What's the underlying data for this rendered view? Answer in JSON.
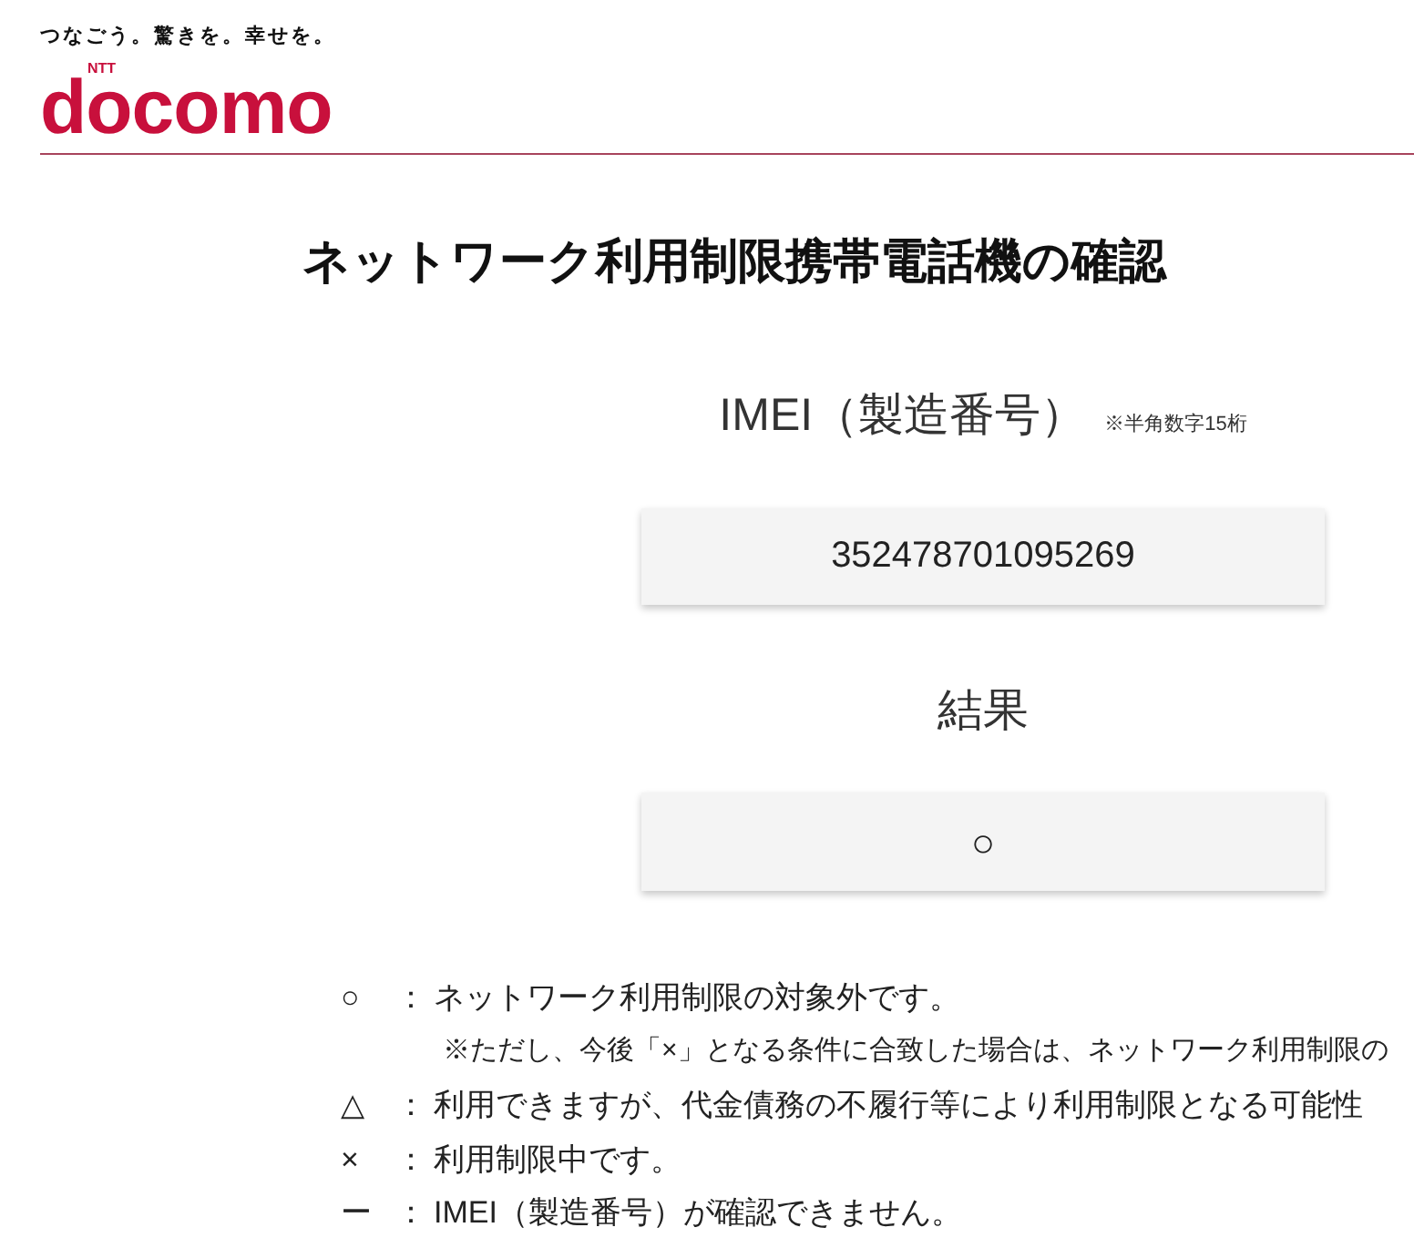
{
  "header": {
    "tagline": "つなごう。驚きを。幸せを。",
    "logo": {
      "mark": "NTT",
      "word": "docomo"
    }
  },
  "title": "ネットワーク利用制限携帯電話機の確認",
  "imei_field": {
    "label": "IMEI（製造番号）",
    "note": "※半角数字15桁",
    "value": "352478701095269"
  },
  "result": {
    "label": "結果",
    "value": "○"
  },
  "legend": [
    {
      "kind": "entry",
      "symbol": "○",
      "separator": "：",
      "text": "ネットワーク利用制限の対象外です。"
    },
    {
      "kind": "note",
      "text": "※ただし、今後「×」となる条件に合致した場合は、ネットワーク利用制限の"
    },
    {
      "kind": "entry",
      "symbol": "△",
      "separator": "：",
      "text": "利用できますが、代金債務の不履行等により利用制限となる可能性"
    },
    {
      "kind": "entry",
      "symbol": "×",
      "separator": "：",
      "text": "利用制限中です。"
    },
    {
      "kind": "entry",
      "symbol": "ー",
      "separator": "：",
      "text": "IMEI（製造番号）が確認できません。"
    }
  ]
}
